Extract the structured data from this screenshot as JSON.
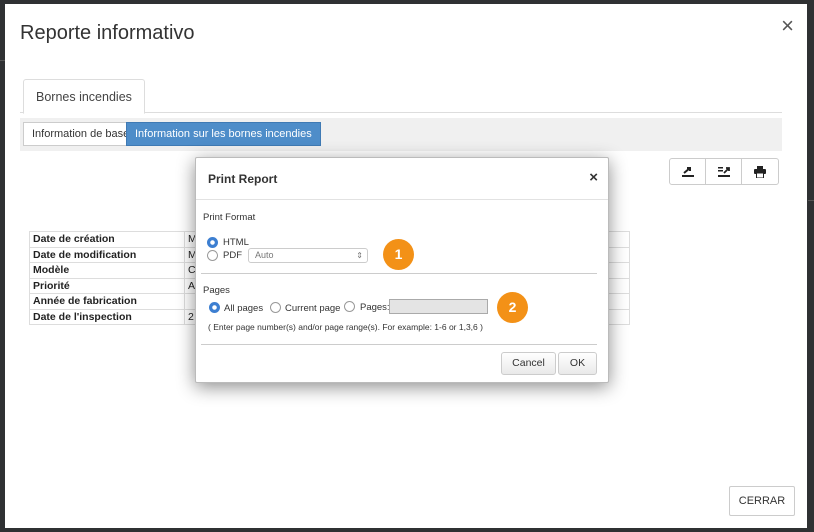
{
  "modal": {
    "title": "Reporte informativo",
    "close": "×",
    "tab": "Bornes incendies",
    "subtabs": [
      "Information de base",
      "Information sur les bornes incendies"
    ],
    "toolbar_icons": [
      "export-icon",
      "export-list-icon",
      "print-icon"
    ],
    "table_rows": [
      {
        "label": "Date de création",
        "value": "M"
      },
      {
        "label": "Date de modification",
        "value": "M"
      },
      {
        "label": "Modèle",
        "value": "C"
      },
      {
        "label": "Priorité",
        "value": "A"
      },
      {
        "label": "Année de fabrication",
        "value": ""
      },
      {
        "label": "Date de l'inspection",
        "value": "2"
      }
    ],
    "close_button": "CERRAR"
  },
  "dialog": {
    "title": "Print Report",
    "close": "×",
    "print_format_label": "Print Format",
    "format_html": "HTML",
    "format_pdf": "PDF",
    "pdf_select_value": "Auto",
    "selected_format": "HTML",
    "pages_label": "Pages",
    "all_pages": "All pages",
    "current_page": "Current page",
    "pages_option": "Pages:",
    "pages_input_value": "",
    "selected_pages": "All pages",
    "hint": "( Enter page number(s) and/or page range(s). For example: 1-6 or 1,3,6 )",
    "cancel": "Cancel",
    "ok": "OK"
  },
  "badges": [
    "1",
    "2"
  ],
  "colors": {
    "accent": "#4e8dc9",
    "badge": "#f39117",
    "radio": "#3d7fd1"
  }
}
